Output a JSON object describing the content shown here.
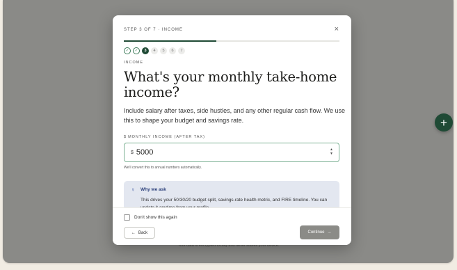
{
  "modal": {
    "step_label": "STEP 3 OF 7 · INCOME",
    "close_icon": "×",
    "progress_fraction": 0.43,
    "steps": [
      {
        "label": "✓",
        "state": "done"
      },
      {
        "label": "✓",
        "state": "done"
      },
      {
        "label": "3",
        "state": "current"
      },
      {
        "label": "4",
        "state": "todo"
      },
      {
        "label": "5",
        "state": "todo"
      },
      {
        "label": "6",
        "state": "todo"
      },
      {
        "label": "7",
        "state": "todo"
      }
    ],
    "section_label": "INCOME",
    "title": "What's your monthly take-home income?",
    "description": "Include salary after taxes, side hustles, and any other regular cash flow. We use this to shape your budget and savings rate.",
    "field": {
      "currency_symbol": "$",
      "label": "MONTHLY INCOME (AFTER TAX)",
      "prefix": "$",
      "value": "5000",
      "helper": "We'll convert this to annual numbers automatically."
    },
    "info": {
      "icon": "♀",
      "title": "Why we ask",
      "body": "This drives your 50/30/20 budget split, savings-rate health metric, and FIRE timeline. You can update it anytime from your profile."
    },
    "footer": {
      "checkbox_label": "Don't show this again",
      "back_label": "Back",
      "back_icon": "←",
      "continue_label": "Continue",
      "continue_icon": "→"
    }
  },
  "fab_icon": "+",
  "footer_note": "Your data is encrypted locally and never leaves your device.",
  "colors": {
    "accent": "#1f4a35",
    "overlay": "#8a8a87",
    "info_bg": "#e3e7f0",
    "continue_disabled": "#8b8b87"
  }
}
